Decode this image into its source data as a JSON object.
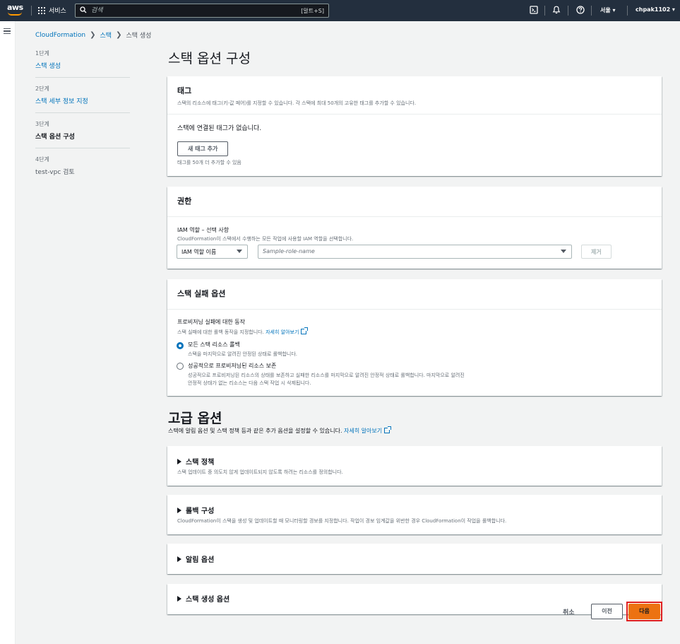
{
  "topnav": {
    "logo": "aws",
    "services_label": "서비스",
    "search_placeholder": "검색",
    "search_shortcut": "[알트+S]",
    "region": "서울 ▾",
    "account": "chpak1102 ▾",
    "icons": [
      "grid-icon",
      "search-icon",
      "cloudshell-icon",
      "bell-icon",
      "help-icon"
    ]
  },
  "breadcrumb": {
    "root": "CloudFormation",
    "parent": "스택",
    "current": "스택 생성"
  },
  "steps": [
    {
      "num": "1단계",
      "name": "스택 생성",
      "state": "link"
    },
    {
      "num": "2단계",
      "name": "스택 세부 정보 지정",
      "state": "link"
    },
    {
      "num": "3단계",
      "name": "스택 옵션 구성",
      "state": "active"
    },
    {
      "num": "4단계",
      "name": "test-vpc 검토",
      "state": "disabled"
    }
  ],
  "page_title": "스택 옵션 구성",
  "tags": {
    "title": "태그",
    "desc": "스택의 리소스에 태그(키-값 페어)를 지정할 수 있습니다. 각 스택에 최대 50개의 고유한 태그를 추가할 수 있습니다.",
    "empty_text": "스택에 연결된 태그가 없습니다.",
    "add_button": "새 태그 추가",
    "hint": "태그를 50개 더 추가할 수 있음"
  },
  "permissions": {
    "title": "권한",
    "iam_label": "IAM 역할 – 선택 사항",
    "iam_desc": "CloudFormation이 스택에서 수행하는 모든 작업에 사용할 IAM 역할을 선택합니다.",
    "role_type": "IAM 역할 이름",
    "role_placeholder": "Sample-role-name",
    "remove_button": "제거"
  },
  "failure": {
    "title": "스택 실패 옵션",
    "label": "프로비저닝 실패에 대한 동작",
    "desc": "스택 실패에 대한 롤백 동작을 지정합니다.",
    "learn_more": "자세히 알아보기",
    "option1_label": "모든 스택 리소스 롤백",
    "option1_desc": "스택을 마지막으로 알려진 안정된 상태로 롤백합니다.",
    "option2_label": "성공적으로 프로비저닝된 리소스 보존",
    "option2_desc_line1": "성공적으로 프로비저닝된 리소스의 상태를 보존하고 실패한 리소스를 마지막으로 알려진 안정적 상태로 롤백합니다. 마지막으로 알려진",
    "option2_desc_line2": "안정적 상태가 없는 리소스는 다음 스택 작업 시 삭제됩니다.",
    "selected": 1
  },
  "advanced": {
    "title": "고급 옵션",
    "desc": "스택에 알림 옵션 및 스택 정책 등과 같은 추가 옵션을 설정할 수 있습니다.",
    "learn_more": "자세히 알아보기",
    "sections": [
      {
        "title": "스택 정책",
        "desc": "스택 업데이트 중 의도치 않게 업데이트되지 않도록 하려는 리소스를 정의합니다."
      },
      {
        "title": "롤백 구성",
        "desc": "CloudFormation이 스택을 생성 및 업데이트할 때 모니터링할 경보를 지정합니다. 작업이 경보 임계값을 위반한 경우 CloudFormation이 작업을 롤백합니다."
      },
      {
        "title": "알림 옵션",
        "desc": ""
      },
      {
        "title": "스택 생성 옵션",
        "desc": ""
      }
    ]
  },
  "footer": {
    "cancel": "취소",
    "previous": "이전",
    "next": "다음"
  },
  "colors": {
    "nav_bg": "#232f3e",
    "link": "#0073bb",
    "primary": "#ec7211",
    "highlight": "#e01e1e"
  }
}
